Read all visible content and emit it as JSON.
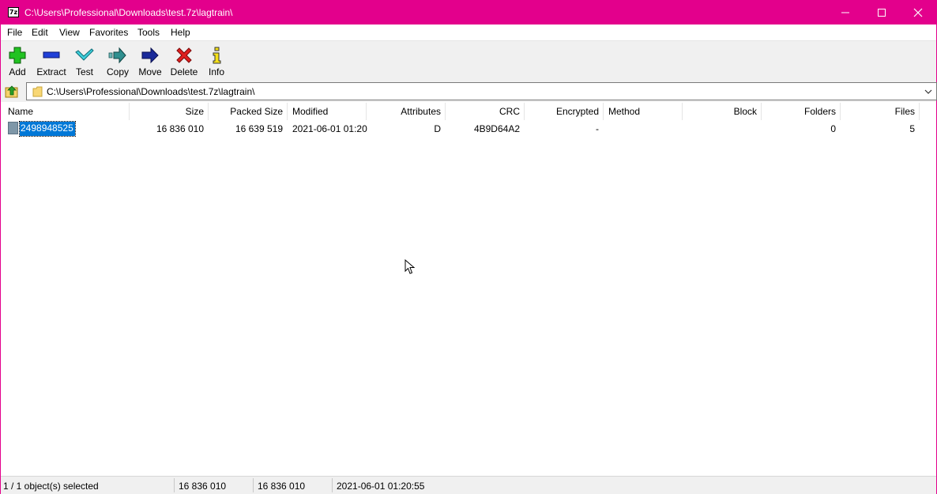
{
  "window": {
    "title": "C:\\Users\\Professional\\Downloads\\test.7z\\lagtrain\\",
    "app_icon_text": "7z",
    "accent_color": "#e3008c"
  },
  "menu": [
    "File",
    "Edit",
    "View",
    "Favorites",
    "Tools",
    "Help"
  ],
  "toolbar": {
    "add": "Add",
    "extract": "Extract",
    "test": "Test",
    "copy": "Copy",
    "move": "Move",
    "delete": "Delete",
    "info": "Info"
  },
  "address": {
    "path": "C:\\Users\\Professional\\Downloads\\test.7z\\lagtrain\\"
  },
  "columns": {
    "name": "Name",
    "size": "Size",
    "packed_size": "Packed Size",
    "modified": "Modified",
    "attributes": "Attributes",
    "crc": "CRC",
    "encrypted": "Encrypted",
    "method": "Method",
    "block": "Block",
    "folders": "Folders",
    "files": "Files"
  },
  "rows": [
    {
      "name": "2498948525",
      "size": "16 836 010",
      "packed_size": "16 639 519",
      "modified": "2021-06-01 01:20",
      "attributes": "D",
      "crc": "4B9D64A2",
      "encrypted": "-",
      "method": "",
      "block": "",
      "folders": "0",
      "files": "5",
      "selected": true
    }
  ],
  "status": {
    "selection": "1 / 1 object(s) selected",
    "size": "16 836 010",
    "packed_size": "16 836 010",
    "modified": "2021-06-01 01:20:55"
  }
}
